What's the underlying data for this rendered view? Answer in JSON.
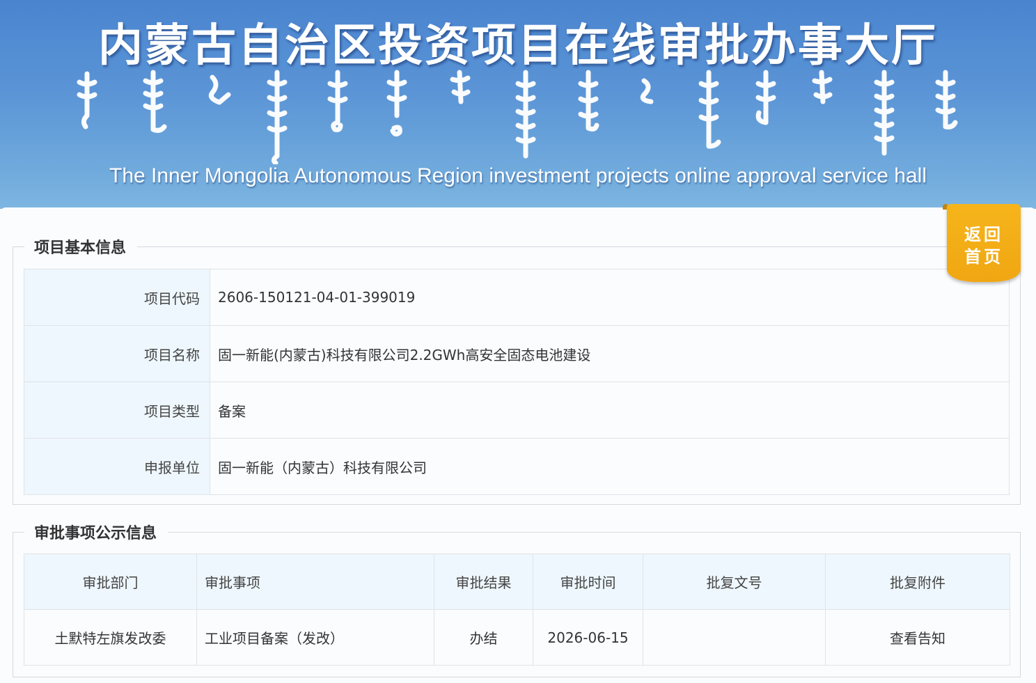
{
  "banner": {
    "title": "内蒙古自治区投资项目在线审批办事大厅",
    "subtitle": "The Inner Mongolia Autonomous Region investment projects online approval service hall"
  },
  "home_button": {
    "line1": "返回",
    "line2": "首页"
  },
  "project_info": {
    "heading": "项目基本信息",
    "rows": [
      {
        "label": "项目代码",
        "value": "2606-150121-04-01-399019"
      },
      {
        "label": "项目名称",
        "value": "固一新能(内蒙古)科技有限公司2.2GWh高安全固态电池建设"
      },
      {
        "label": "项目类型",
        "value": "备案"
      },
      {
        "label": "申报单位",
        "value": "固一新能（内蒙古）科技有限公司"
      }
    ]
  },
  "approval_info": {
    "heading": "审批事项公示信息",
    "columns": [
      "审批部门",
      "审批事项",
      "审批结果",
      "审批时间",
      "批复文号",
      "批复附件"
    ],
    "rows": [
      {
        "dept": "土默特左旗发改委",
        "item": "工业项目备案（发改）",
        "result": "办结",
        "date": "2026-06-15",
        "doc_no": "",
        "attachment": "查看告知"
      }
    ]
  }
}
